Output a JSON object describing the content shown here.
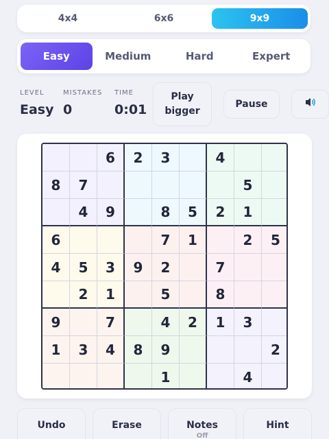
{
  "size_tabs": [
    {
      "label": "4x4",
      "active": false
    },
    {
      "label": "6x6",
      "active": false
    },
    {
      "label": "9x9",
      "active": true
    }
  ],
  "difficulty_tabs": [
    {
      "label": "Easy",
      "active": true
    },
    {
      "label": "Medium",
      "active": false
    },
    {
      "label": "Hard",
      "active": false
    },
    {
      "label": "Expert",
      "active": false
    }
  ],
  "info": {
    "level_label": "LEVEL",
    "level_value": "Easy",
    "mistakes_label": "MISTAKES",
    "mistakes_value": "0",
    "time_label": "TIME",
    "time_value": "0:01"
  },
  "buttons": {
    "play_bigger_line1": "Play",
    "play_bigger_line2": "bigger",
    "pause": "Pause",
    "sound_icon": "speaker-icon"
  },
  "board": {
    "rows": [
      [
        "",
        "",
        "6",
        "2",
        "3",
        "",
        "4",
        "",
        ""
      ],
      [
        "8",
        "7",
        "",
        "",
        "",
        "",
        "",
        "5",
        ""
      ],
      [
        "",
        "4",
        "9",
        "",
        "8",
        "5",
        "2",
        "1",
        ""
      ],
      [
        "6",
        "",
        "",
        "",
        "7",
        "1",
        "",
        "2",
        "5"
      ],
      [
        "4",
        "5",
        "3",
        "9",
        "2",
        "",
        "7",
        "",
        ""
      ],
      [
        "",
        "2",
        "1",
        "",
        "5",
        "",
        "8",
        "",
        ""
      ],
      [
        "9",
        "",
        "7",
        "",
        "4",
        "2",
        "1",
        "3",
        ""
      ],
      [
        "1",
        "3",
        "4",
        "8",
        "9",
        "",
        "",
        "",
        "2"
      ],
      [
        "",
        "",
        "",
        "",
        "1",
        "",
        "",
        "4",
        ""
      ]
    ],
    "box_colors": [
      [
        "#f2f1fd",
        "#eef9fd",
        "#edfaf3"
      ],
      [
        "#fefaec",
        "#fdf1ef",
        "#fdf0f4"
      ],
      [
        "#fdf4ef",
        "#eff8ec",
        "#f3f2fd"
      ]
    ]
  },
  "bottom_actions": [
    {
      "label": "Undo",
      "sub": ""
    },
    {
      "label": "Erase",
      "sub": ""
    },
    {
      "label": "Notes",
      "sub": "Off"
    },
    {
      "label": "Hint",
      "sub": ""
    }
  ],
  "colors": {
    "accent_blue": "#1a8ee8",
    "accent_purple": "#6a50ee",
    "grid_border": "#2e3148"
  }
}
